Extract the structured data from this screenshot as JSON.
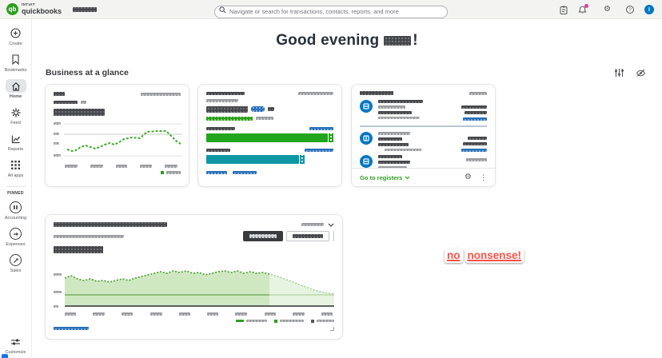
{
  "topbar": {
    "brand_intuit": "INTUIT",
    "brand_product": "quickbooks",
    "search_placeholder": "Navigate or search for transactions, contacts, reports, and more",
    "help_glyph": "?",
    "avatar_initial": "I"
  },
  "sidebar": {
    "items": [
      {
        "label": "Create"
      },
      {
        "label": "Bookmarks"
      },
      {
        "label": "Home"
      },
      {
        "label": "Feed"
      },
      {
        "label": "Reports"
      },
      {
        "label": "All apps"
      }
    ],
    "pinned_label": "PINNED",
    "pinned_items": [
      {
        "label": "Accounting"
      },
      {
        "label": "Expenses"
      },
      {
        "label": "Sales"
      }
    ],
    "customize_label": "Customize"
  },
  "main": {
    "greeting_prefix": "Good evening",
    "greeting_suffix": "!",
    "section_title": "Business at a glance",
    "bank_card": {
      "footer_link": "Go to registers"
    },
    "sticker": {
      "text": "no nonsense!",
      "words": [
        "no",
        "nonsense!"
      ]
    }
  },
  "colors": {
    "qb_green": "#2ca01c",
    "link_blue": "#0077c5",
    "bar_green": "#21a51c",
    "bar_teal": "#0e97a5",
    "notification_pink": "#e5399e",
    "sticker_red": "#ff5147",
    "toggle_charcoal": "#393a3d"
  }
}
